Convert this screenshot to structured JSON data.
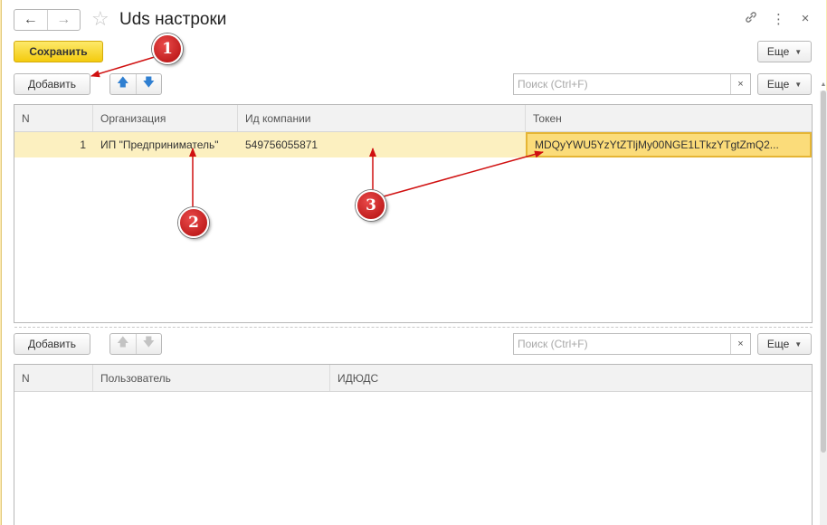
{
  "window": {
    "title": "Uds настроки"
  },
  "header": {
    "back_icon": "←",
    "forward_icon": "→",
    "star_icon": "☆",
    "link_icon": "🔗",
    "menu_icon": "⋮",
    "close_icon": "×"
  },
  "toolbar": {
    "save_label": "Сохранить",
    "more_label": "Еще"
  },
  "top_section": {
    "add_label": "Добавить",
    "up_icon": "🡅",
    "down_icon": "🡇",
    "search_placeholder": "Поиск (Ctrl+F)",
    "clear_icon": "×",
    "more_label": "Еще",
    "table": {
      "columns": [
        "N",
        "Организация",
        "Ид компании",
        "Токен"
      ],
      "rows": [
        {
          "n": "1",
          "organization": "ИП \"Предприниматель\"",
          "company_id": "549756055871",
          "token": "MDQyYWU5YzYtZTljMy00NGE1LTkzYTgtZmQ2..."
        }
      ]
    }
  },
  "bottom_section": {
    "add_label": "Добавить",
    "up_icon": "🡅",
    "down_icon": "🡇",
    "search_placeholder": "Поиск (Ctrl+F)",
    "clear_icon": "×",
    "more_label": "Еще",
    "table": {
      "columns": [
        "N",
        "Пользователь",
        "ИДЮДС"
      ]
    }
  },
  "annotations": [
    "1",
    "2",
    "3"
  ],
  "colors": {
    "accent_yellow": "#f4cb0e",
    "selection": "#fbdc7a",
    "annotation_red": "#d01010"
  }
}
